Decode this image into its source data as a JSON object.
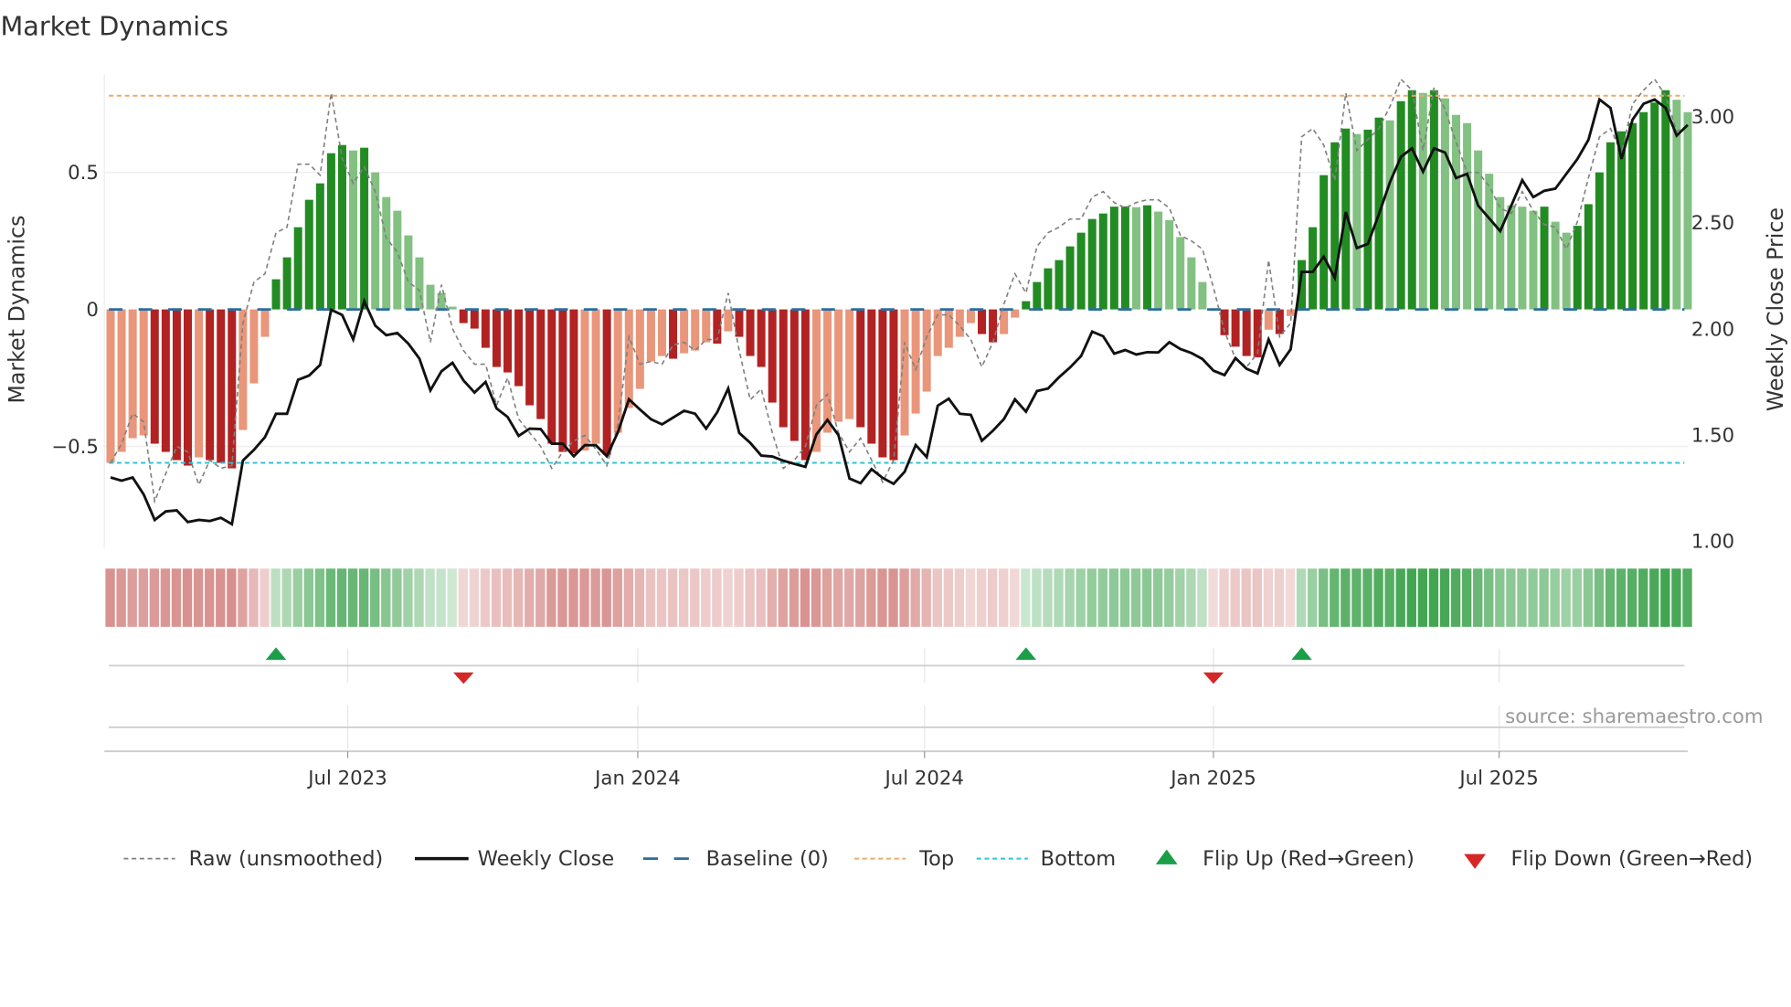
{
  "chart_data": {
    "type": "bar",
    "title": "Market Dynamics",
    "ylabel": "Market Dynamics",
    "y2label": "Weekly Close Price",
    "ylim": [
      -0.87,
      0.86
    ],
    "y2lim": [
      1.0,
      3.2
    ],
    "yticks": [
      {
        "v": 0.5,
        "label": "0.5"
      },
      {
        "v": 0,
        "label": "0"
      },
      {
        "v": -0.5,
        "label": "−0.5"
      }
    ],
    "y2ticks": [
      {
        "v": 3.0,
        "label": "3.00"
      },
      {
        "v": 2.5,
        "label": "2.50"
      },
      {
        "v": 2.0,
        "label": "2.00"
      },
      {
        "v": 1.5,
        "label": "1.50"
      },
      {
        "v": 1.0,
        "label": "1.00"
      }
    ],
    "xticks": [
      {
        "week_index": 21.5,
        "label": "Jul 2023"
      },
      {
        "week_index": 47.8,
        "label": "Jan 2024"
      },
      {
        "week_index": 73.8,
        "label": "Jul 2024"
      },
      {
        "week_index": 100.0,
        "label": "Jan 2025"
      },
      {
        "week_index": 125.9,
        "label": "Jul 2025"
      }
    ],
    "top_level": 0.78,
    "bottom_level": -0.56,
    "baseline": 0,
    "market_dynamics": [
      -0.56,
      -0.52,
      -0.47,
      -0.46,
      -0.49,
      -0.52,
      -0.55,
      -0.57,
      -0.54,
      -0.55,
      -0.56,
      -0.58,
      -0.44,
      -0.27,
      -0.1,
      0.11,
      0.19,
      0.3,
      0.4,
      0.46,
      0.57,
      0.6,
      0.58,
      0.59,
      0.5,
      0.41,
      0.36,
      0.27,
      0.19,
      0.09,
      0.06,
      0.01,
      -0.05,
      -0.07,
      -0.14,
      -0.21,
      -0.23,
      -0.28,
      -0.35,
      -0.4,
      -0.49,
      -0.52,
      -0.525,
      -0.515,
      -0.49,
      -0.53,
      -0.45,
      -0.36,
      -0.29,
      -0.19,
      -0.17,
      -0.18,
      -0.16,
      -0.15,
      -0.12,
      -0.125,
      -0.08,
      -0.1,
      -0.17,
      -0.21,
      -0.34,
      -0.43,
      -0.48,
      -0.55,
      -0.52,
      -0.45,
      -0.41,
      -0.4,
      -0.43,
      -0.49,
      -0.54,
      -0.55,
      -0.46,
      -0.38,
      -0.3,
      -0.17,
      -0.14,
      -0.1,
      -0.05,
      -0.09,
      -0.12,
      -0.09,
      -0.03,
      0.03,
      0.1,
      0.15,
      0.18,
      0.23,
      0.28,
      0.33,
      0.35,
      0.375,
      0.376,
      0.373,
      0.38,
      0.357,
      0.326,
      0.264,
      0.19,
      0.1,
      -0.005,
      -0.094,
      -0.136,
      -0.17,
      -0.175,
      -0.074,
      -0.09,
      -0.024,
      0.18,
      0.3,
      0.49,
      0.61,
      0.66,
      0.64,
      0.656,
      0.7,
      0.69,
      0.76,
      0.8,
      0.79,
      0.8,
      0.77,
      0.71,
      0.68,
      0.58,
      0.495,
      0.41,
      0.38,
      0.375,
      0.36,
      0.375,
      0.32,
      0.28,
      0.305,
      0.384,
      0.5,
      0.61,
      0.65,
      0.68,
      0.72,
      0.755,
      0.8,
      0.765,
      0.72
    ],
    "raw_unsmoothed": [
      -0.56,
      -0.49,
      -0.38,
      -0.41,
      -0.7,
      -0.6,
      -0.5,
      -0.52,
      -0.64,
      -0.55,
      -0.58,
      -0.57,
      -0.05,
      0.1,
      0.13,
      0.28,
      0.3,
      0.53,
      0.53,
      0.49,
      0.79,
      0.55,
      0.46,
      0.52,
      0.43,
      0.26,
      0.21,
      0.1,
      0.07,
      -0.12,
      0.09,
      -0.07,
      -0.15,
      -0.2,
      -0.2,
      -0.35,
      -0.25,
      -0.4,
      -0.45,
      -0.5,
      -0.58,
      -0.52,
      -0.48,
      -0.46,
      -0.51,
      -0.57,
      -0.42,
      -0.1,
      -0.2,
      -0.19,
      -0.2,
      -0.13,
      -0.12,
      -0.15,
      -0.11,
      -0.11,
      0.06,
      -0.15,
      -0.33,
      -0.29,
      -0.45,
      -0.58,
      -0.55,
      -0.5,
      -0.35,
      -0.31,
      -0.45,
      -0.52,
      -0.47,
      -0.55,
      -0.63,
      -0.55,
      -0.12,
      -0.22,
      -0.1,
      -0.02,
      -0.02,
      -0.06,
      -0.11,
      -0.21,
      -0.12,
      0.02,
      0.13,
      0.06,
      0.23,
      0.28,
      0.3,
      0.33,
      0.33,
      0.41,
      0.43,
      0.39,
      0.37,
      0.39,
      0.4,
      0.4,
      0.37,
      0.27,
      0.25,
      0.22,
      0.08,
      -0.08,
      -0.18,
      -0.21,
      -0.16,
      0.18,
      -0.1,
      -0.05,
      0.63,
      0.66,
      0.6,
      0.47,
      0.79,
      0.58,
      0.62,
      0.66,
      0.74,
      0.84,
      0.8,
      0.58,
      0.81,
      0.73,
      0.61,
      0.5,
      0.5,
      0.45,
      0.37,
      0.35,
      0.43,
      0.36,
      0.31,
      0.3,
      0.22,
      0.32,
      0.48,
      0.63,
      0.66,
      0.57,
      0.75,
      0.8,
      0.84,
      0.78,
      0.65,
      0.67
    ],
    "weekly_close": [
      1.3,
      1.285,
      1.3,
      1.22,
      1.1,
      1.14,
      1.145,
      1.09,
      1.1,
      1.095,
      1.11,
      1.08,
      1.38,
      1.43,
      1.49,
      1.6,
      1.6,
      1.76,
      1.78,
      1.83,
      2.09,
      2.065,
      1.95,
      2.13,
      2.015,
      1.97,
      1.98,
      1.93,
      1.86,
      1.71,
      1.8,
      1.84,
      1.757,
      1.7,
      1.75,
      1.625,
      1.585,
      1.496,
      1.53,
      1.528,
      1.459,
      1.459,
      1.4,
      1.452,
      1.452,
      1.4,
      1.513,
      1.668,
      1.62,
      1.574,
      1.55,
      1.582,
      1.614,
      1.6,
      1.53,
      1.607,
      1.719,
      1.51,
      1.463,
      1.403,
      1.399,
      1.379,
      1.364,
      1.35,
      1.503,
      1.571,
      1.499,
      1.295,
      1.273,
      1.339,
      1.298,
      1.27,
      1.327,
      1.453,
      1.396,
      1.638,
      1.671,
      1.6,
      1.595,
      1.473,
      1.52,
      1.575,
      1.668,
      1.61,
      1.707,
      1.719,
      1.772,
      1.818,
      1.872,
      1.987,
      1.965,
      1.883,
      1.9,
      1.879,
      1.89,
      1.889,
      1.937,
      1.905,
      1.886,
      1.858,
      1.803,
      1.782,
      1.862,
      1.812,
      1.79,
      1.95,
      1.83,
      1.904,
      2.268,
      2.268,
      2.34,
      2.24,
      2.55,
      2.38,
      2.4,
      2.54,
      2.69,
      2.81,
      2.85,
      2.74,
      2.85,
      2.83,
      2.71,
      2.73,
      2.58,
      2.52,
      2.46,
      2.58,
      2.7,
      2.62,
      2.65,
      2.66,
      2.73,
      2.8,
      2.89,
      3.08,
      3.04,
      2.8,
      2.985,
      3.06,
      3.08,
      3.04,
      2.91,
      2.96
    ],
    "flips": [
      {
        "week_index": 15,
        "direction": "up"
      },
      {
        "week_index": 32,
        "direction": "down"
      },
      {
        "week_index": 83,
        "direction": "up"
      },
      {
        "week_index": 100,
        "direction": "down"
      },
      {
        "week_index": 108,
        "direction": "up"
      }
    ],
    "legend": {
      "placement": "bottom",
      "items": [
        {
          "key": "raw",
          "label": "Raw (unsmoothed)"
        },
        {
          "key": "close",
          "label": "Weekly Close"
        },
        {
          "key": "baseline",
          "label": "Baseline (0)"
        },
        {
          "key": "top",
          "label": "Top"
        },
        {
          "key": "bottom",
          "label": "Bottom"
        },
        {
          "key": "flipup",
          "label": "Flip Up (Red→Green)"
        },
        {
          "key": "flipdown",
          "label": "Flip Down (Green→Red)"
        }
      ]
    },
    "source": "source: sharemaestro.com",
    "colors": {
      "neg_falling": "#b22222",
      "neg_rising": "#e9967a",
      "pos_rising": "#228b22",
      "pos_falling": "#82c182",
      "baseline": "#2b6e9e",
      "top": "#f0a868",
      "bottom": "#2ec4d6",
      "close": "#111111",
      "raw": "#808080",
      "flip_up": "#1a9e48",
      "flip_down": "#d62728"
    }
  }
}
